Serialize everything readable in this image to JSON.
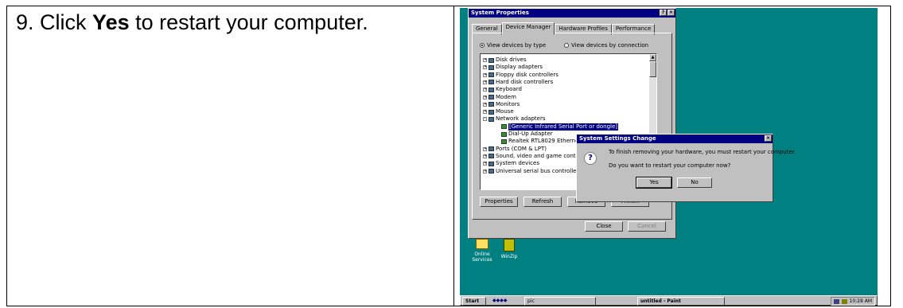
{
  "instruction": {
    "step_number": "9.",
    "before": "Click ",
    "keyword": "Yes",
    "after": " to restart your computer."
  },
  "system_properties": {
    "title": "System Properties",
    "tabs": [
      "General",
      "Device Manager",
      "Hardware Profiles",
      "Performance"
    ],
    "active_tab": "Device Manager",
    "view_by_type": "View devices by type",
    "view_by_connection": "View devices by connection",
    "devices": [
      {
        "label": "Disk drives",
        "expander": "+"
      },
      {
        "label": "Display adapters",
        "expander": "+"
      },
      {
        "label": "Floppy disk controllers",
        "expander": "+"
      },
      {
        "label": "Hard disk controllers",
        "expander": "+"
      },
      {
        "label": "Keyboard",
        "expander": "+"
      },
      {
        "label": "Modem",
        "expander": "+"
      },
      {
        "label": "Monitors",
        "expander": "+"
      },
      {
        "label": "Mouse",
        "expander": "+"
      },
      {
        "label": "Network adapters",
        "expander": "-"
      },
      {
        "label": "[Generic Infrared Serial Port or dongle]",
        "expander": "",
        "child": true,
        "selected": true
      },
      {
        "label": "Dial-Up Adapter",
        "expander": "",
        "child": true
      },
      {
        "label": "Realtek RTL8029 Etherne",
        "expander": "",
        "child": true
      },
      {
        "label": "Ports (COM & LPT)",
        "expander": "+"
      },
      {
        "label": "Sound, video and game contr",
        "expander": "+"
      },
      {
        "label": "System devices",
        "expander": "+"
      },
      {
        "label": "Universal serial bus controller",
        "expander": "+"
      }
    ],
    "buttons": {
      "properties": "Properties",
      "refresh": "Refresh",
      "remove": "Remove",
      "print": "Print...",
      "close": "Close",
      "cancel": "Cancel"
    },
    "title_buttons": {
      "help": "?",
      "close": "×"
    }
  },
  "dialog": {
    "title": "System Settings Change",
    "close": "×",
    "icon_glyph": "?",
    "message1": "To finish removing your hardware, you must restart your computer.",
    "message2": "Do you want to restart your computer now?",
    "yes": "Yes",
    "no": "No"
  },
  "desktop": {
    "online_services": "Online Services",
    "winzip": "WinZip"
  },
  "taskbar": {
    "start": "Start",
    "task1": "pic",
    "task2": "untitled - Paint",
    "clock": "10:28 AM"
  }
}
